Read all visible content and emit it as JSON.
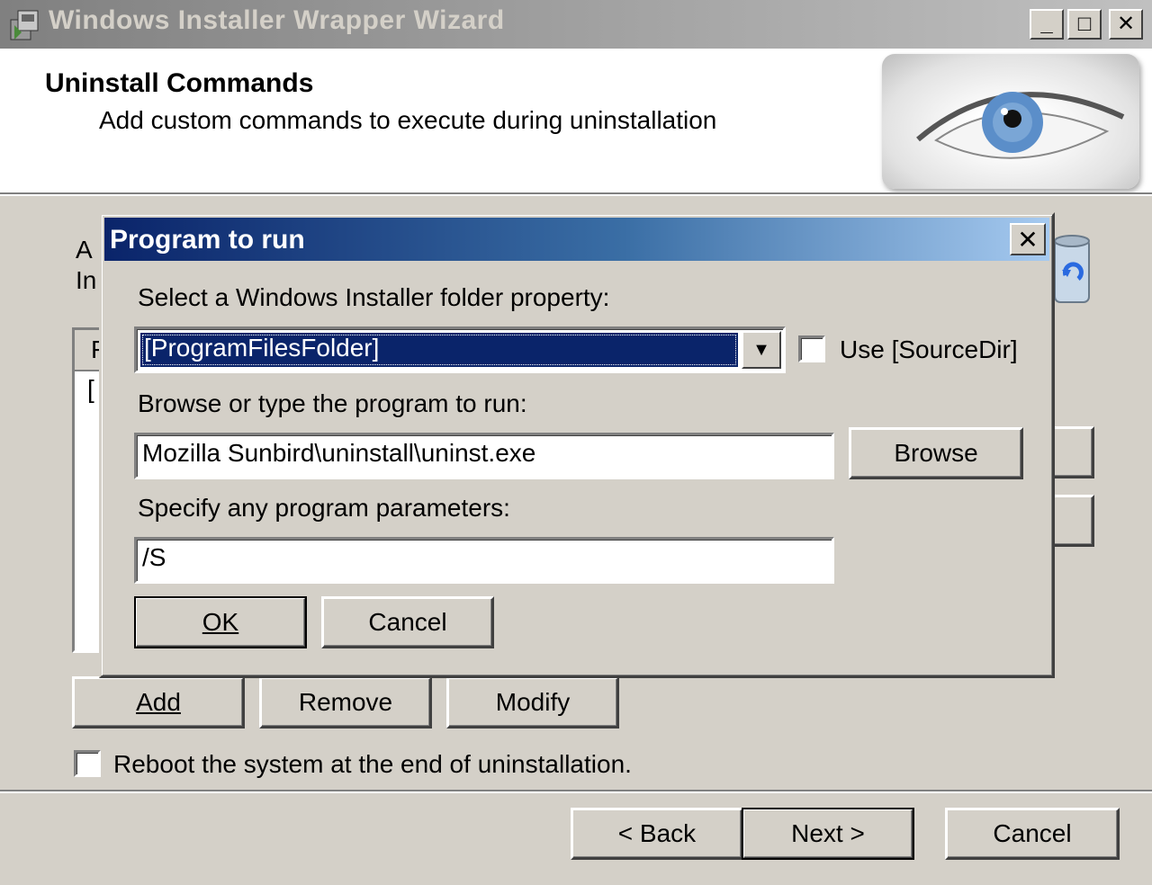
{
  "window": {
    "title": "Windows Installer Wrapper Wizard",
    "minimize_glyph": "_",
    "maximize_glyph": "□",
    "close_glyph": "✕"
  },
  "header": {
    "title": "Uninstall Commands",
    "subtitle": "Add custom commands to execute during uninstallation",
    "image_icon": "eye-icon"
  },
  "underlying": {
    "label_line1": "A",
    "label_line2": "In",
    "list_col_header": "F",
    "list_first_cell": "[",
    "add_label": "Add",
    "remove_label": "Remove",
    "modify_label": "Modify",
    "reboot_label": "Reboot the system at the end of uninstallation.",
    "reboot_checked": false
  },
  "dialog": {
    "title": "Program to run",
    "close_glyph": "✕",
    "folder_label": "Select a Windows Installer folder property:",
    "folder_value": "[ProgramFilesFolder]",
    "use_sourcedir_label": "Use [SourceDir]",
    "use_sourcedir_checked": false,
    "program_label": "Browse or type the program to run:",
    "program_value": "Mozilla Sunbird\\uninstall\\uninst.exe",
    "browse_label": "Browse",
    "params_label": "Specify any program parameters:",
    "params_value": "/S",
    "ok_label": "OK",
    "cancel_label": "Cancel"
  },
  "footer": {
    "back_label": "< Back",
    "next_label": "Next >",
    "cancel_label": "Cancel"
  }
}
